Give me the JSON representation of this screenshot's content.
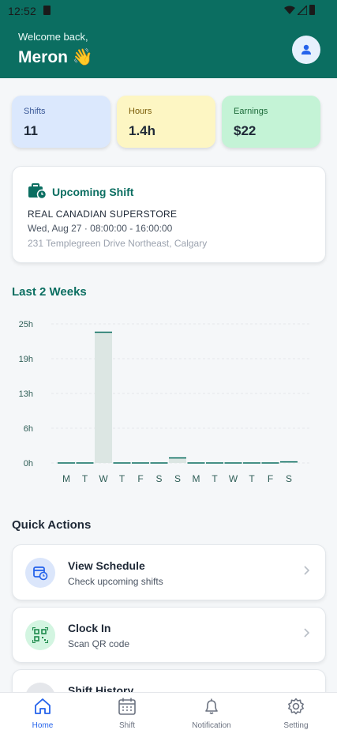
{
  "status_bar": {
    "time": "12:52"
  },
  "header": {
    "welcome": "Welcome back,",
    "username": "Meron 👋"
  },
  "stats": [
    {
      "label": "Shifts",
      "value": "11"
    },
    {
      "label": "Hours",
      "value": "1.4h"
    },
    {
      "label": "Earnings",
      "value": "$22"
    }
  ],
  "upcoming": {
    "title": "Upcoming Shift",
    "store": "REAL CANADIAN SUPERSTORE",
    "when": "Wed, Aug 27 · 08:00:00 - 16:00:00",
    "address": "231 Templegreen Drive Northeast, Calgary"
  },
  "chart_section_title": "Last 2 Weeks",
  "chart_data": {
    "type": "bar",
    "title": "Last 2 Weeks",
    "categories": [
      "M",
      "T",
      "W",
      "T",
      "F",
      "S",
      "S",
      "M",
      "T",
      "W",
      "T",
      "F",
      "S"
    ],
    "values": [
      0,
      0,
      23.5,
      0,
      0,
      0,
      0.9,
      0,
      0,
      0,
      0,
      0,
      0.2
    ],
    "y_ticks": [
      "25h",
      "19h",
      "13h",
      "6h",
      "0h"
    ],
    "ylim": [
      0,
      25
    ],
    "grid": "dashed horizontal",
    "colors": {
      "bar_fill": "#dce6e3",
      "bar_line": "#0b6e61"
    }
  },
  "quick_actions": {
    "title": "Quick Actions",
    "items": [
      {
        "title": "View Schedule",
        "subtitle": "Check upcoming shifts",
        "icon": "calendar-clock-icon"
      },
      {
        "title": "Clock In",
        "subtitle": "Scan QR code",
        "icon": "qr-code-icon"
      },
      {
        "title": "Shift History",
        "subtitle": "",
        "icon": "history-icon"
      }
    ]
  },
  "nav": [
    {
      "label": "Home",
      "icon": "home-icon",
      "active": true
    },
    {
      "label": "Shift",
      "icon": "calendar-icon"
    },
    {
      "label": "Notification",
      "icon": "bell-icon"
    },
    {
      "label": "Setting",
      "icon": "gear-icon"
    }
  ],
  "colors": {
    "primary": "#0b6e61",
    "accent": "#2563eb"
  }
}
